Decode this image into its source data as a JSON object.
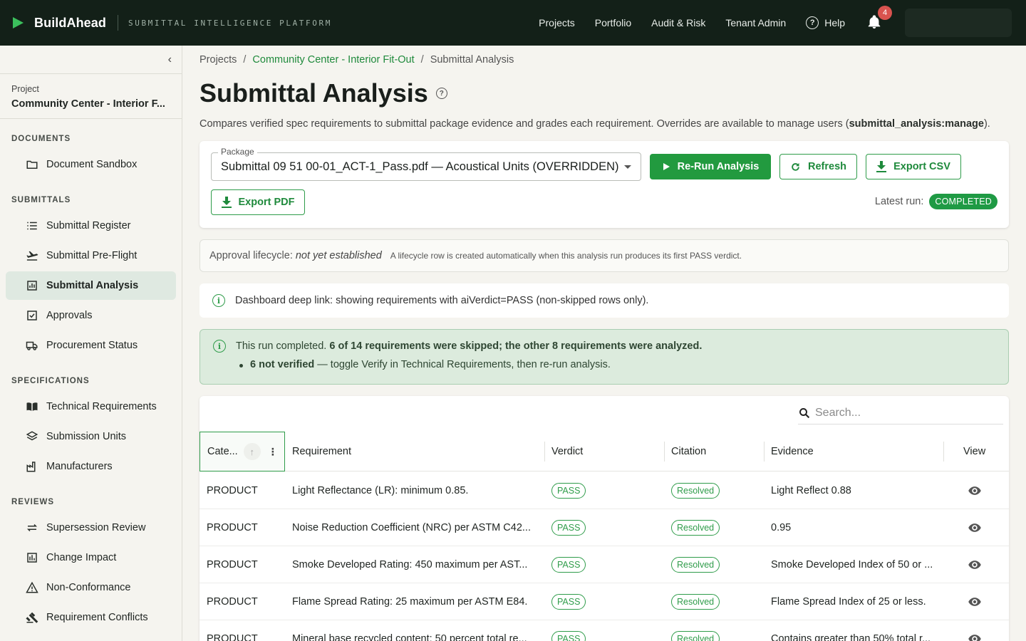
{
  "brand": {
    "name": "BuildAhead",
    "tagline": "SUBMITTAL INTELLIGENCE PLATFORM"
  },
  "nav": {
    "items": [
      "Projects",
      "Portfolio",
      "Audit & Risk",
      "Tenant Admin"
    ],
    "help": "Help",
    "notifications": "4"
  },
  "sidebar": {
    "collapse_glyph": "‹",
    "project_label": "Project",
    "project_name": "Community Center - Interior F...",
    "sections": [
      {
        "title": "DOCUMENTS",
        "items": [
          {
            "label": "Document Sandbox",
            "icon": "folder-icon"
          }
        ]
      },
      {
        "title": "SUBMITTALS",
        "items": [
          {
            "label": "Submittal Register",
            "icon": "list-icon"
          },
          {
            "label": "Submittal Pre-Flight",
            "icon": "takeoff-icon"
          },
          {
            "label": "Submittal Analysis",
            "icon": "analytics-icon",
            "active": true
          },
          {
            "label": "Approvals",
            "icon": "checkbox-icon"
          },
          {
            "label": "Procurement Status",
            "icon": "truck-icon"
          }
        ]
      },
      {
        "title": "SPECIFICATIONS",
        "items": [
          {
            "label": "Technical Requirements",
            "icon": "book-icon"
          },
          {
            "label": "Submission Units",
            "icon": "layers-icon"
          },
          {
            "label": "Manufacturers",
            "icon": "factory-icon"
          }
        ]
      },
      {
        "title": "REVIEWS",
        "items": [
          {
            "label": "Supersession Review",
            "icon": "swap-icon"
          },
          {
            "label": "Change Impact",
            "icon": "chart-icon"
          },
          {
            "label": "Non-Conformance",
            "icon": "warning-icon"
          },
          {
            "label": "Requirement Conflicts",
            "icon": "gavel-icon"
          }
        ]
      }
    ]
  },
  "breadcrumb": {
    "root": "Projects",
    "project": "Community Center - Interior Fit-Out",
    "current": "Submittal Analysis",
    "separator": "/"
  },
  "page": {
    "title": "Submittal Analysis",
    "help_glyph": "?",
    "subtitle_pre": "Compares verified spec requirements to submittal package evidence and grades each requirement. Overrides are available to manage users (",
    "subtitle_perm": "submittal_analysis:manage",
    "subtitle_post": ")."
  },
  "controls": {
    "package_label": "Package",
    "package_value": "Submittal 09 51 00-01_ACT-1_Pass.pdf — Acoustical Units (OVERRIDDEN)",
    "rerun": "Re-Run Analysis",
    "refresh": "Refresh",
    "export_csv": "Export CSV",
    "export_pdf": "Export PDF",
    "latest_label": "Latest run:",
    "latest_status": "COMPLETED"
  },
  "lifecycle": {
    "label": "Approval lifecycle:",
    "value": "not yet established",
    "note": "A lifecycle row is created automatically when this analysis run produces its first PASS verdict."
  },
  "deeplink": {
    "text": "Dashboard deep link: showing requirements with aiVerdict=PASS (non-skipped rows only)."
  },
  "run_note": {
    "pre": "This run completed.",
    "bold": "6 of 14 requirements were skipped; the other 8 requirements were analyzed.",
    "bullet_bold": "6 not verified",
    "bullet_rest": "— toggle Verify in Technical Requirements, then re-run analysis."
  },
  "table": {
    "search_placeholder": "Search...",
    "sort_glyph": "↑",
    "menu_glyph": "⋮",
    "columns": [
      "Cate...",
      "Requirement",
      "Verdict",
      "Citation",
      "Evidence",
      "View"
    ],
    "rows": [
      {
        "category": "PRODUCT",
        "requirement": "Light Reflectance (LR): minimum 0.85.",
        "verdict": "PASS",
        "citation": "Resolved",
        "evidence": "Light Reflect 0.88"
      },
      {
        "category": "PRODUCT",
        "requirement": "Noise Reduction Coefficient (NRC) per ASTM C42...",
        "verdict": "PASS",
        "citation": "Resolved",
        "evidence": "0.95"
      },
      {
        "category": "PRODUCT",
        "requirement": "Smoke Developed Rating: 450 maximum per AST...",
        "verdict": "PASS",
        "citation": "Resolved",
        "evidence": "Smoke Developed Index of 50 or ..."
      },
      {
        "category": "PRODUCT",
        "requirement": "Flame Spread Rating: 25 maximum per ASTM E84.",
        "verdict": "PASS",
        "citation": "Resolved",
        "evidence": "Flame Spread Index of 25 or less."
      },
      {
        "category": "PRODUCT",
        "requirement": "Mineral base recycled content: 50 percent total re...",
        "verdict": "PASS",
        "citation": "Resolved",
        "evidence": "Contains greater than 50% total r..."
      }
    ]
  },
  "colors": {
    "accent": "#229a3f",
    "topbar": "#132018",
    "badge": "#d9534f"
  }
}
